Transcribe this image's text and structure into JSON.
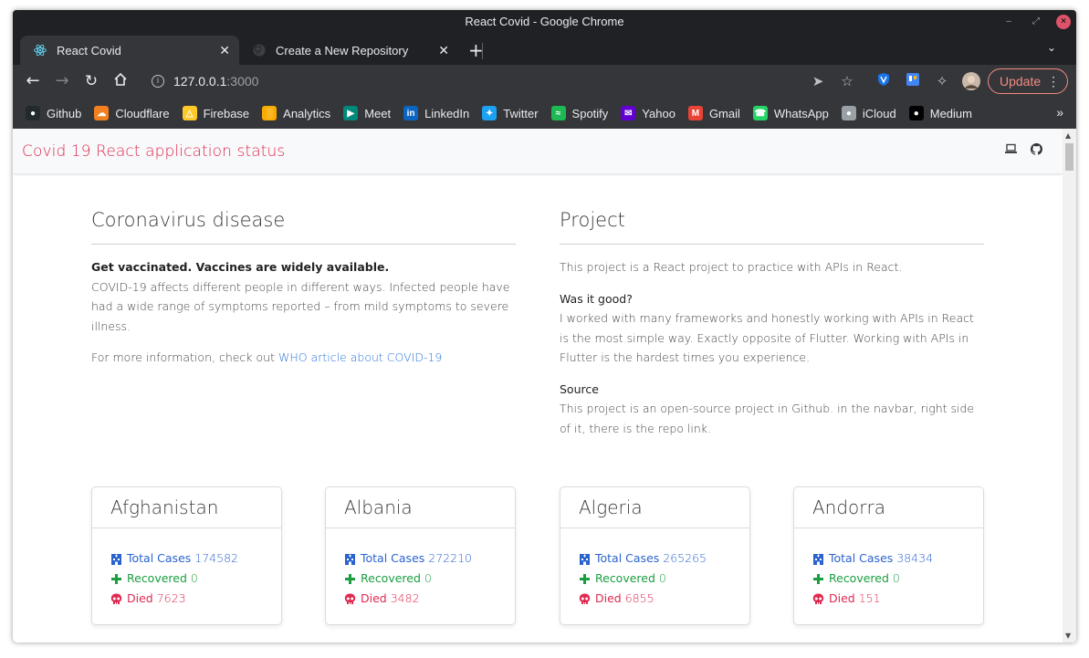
{
  "window": {
    "title": "React Covid - Google Chrome"
  },
  "tabs": [
    {
      "label": "React Covid",
      "active": true,
      "icon": "react-icon"
    },
    {
      "label": "Create a New Repository",
      "active": false,
      "icon": "github-icon"
    }
  ],
  "address": {
    "host": "127.0.0.1",
    "port": ":3000"
  },
  "update_label": "Update",
  "bookmarks": [
    {
      "label": "Github",
      "icon": "github-icon",
      "color": "#24292e"
    },
    {
      "label": "Cloudflare",
      "icon": "cloudflare-icon",
      "color": "#f38020"
    },
    {
      "label": "Firebase",
      "icon": "firebase-icon",
      "color": "#ffca28"
    },
    {
      "label": "Analytics",
      "icon": "analytics-icon",
      "color": "#f9ab00"
    },
    {
      "label": "Meet",
      "icon": "meet-icon",
      "color": "#00897b"
    },
    {
      "label": "LinkedIn",
      "icon": "linkedin-icon",
      "color": "#0a66c2"
    },
    {
      "label": "Twitter",
      "icon": "twitter-icon",
      "color": "#1da1f2"
    },
    {
      "label": "Spotify",
      "icon": "spotify-icon",
      "color": "#1db954"
    },
    {
      "label": "Yahoo",
      "icon": "yahoo-icon",
      "color": "#6001d2"
    },
    {
      "label": "Gmail",
      "icon": "gmail-icon",
      "color": "#ea4335"
    },
    {
      "label": "WhatsApp",
      "icon": "whatsapp-icon",
      "color": "#25d366"
    },
    {
      "label": "iCloud",
      "icon": "apple-icon",
      "color": "#9aa0a6"
    },
    {
      "label": "Medium",
      "icon": "medium-icon",
      "color": "#000000"
    }
  ],
  "navbar": {
    "brand": "Covid 19 React application status"
  },
  "covid": {
    "title": "Coronavirus disease",
    "lead": "Get vaccinated. Vaccines are widely available.",
    "body": "COVID-19 affects different people in different ways. Infected people have had a wide range of symptoms reported – from mild symptoms to severe illness.",
    "more_prefix": "For more information, check out ",
    "more_link": "WHO article about COVID-19"
  },
  "project": {
    "title": "Project",
    "intro": "This project is a React project to practice with APIs in React.",
    "q1": "Was it good?",
    "a1": "I worked with many frameworks and honestly working with APIs in React is the most simple way. Exactly opposite of Flutter. Working with APIs in Flutter is the hardest times you experience.",
    "q2": "Source",
    "a2": "This project is an open-source project in Github. in the navbar, right side of it, there is the repo link."
  },
  "labels": {
    "total": "Total Cases",
    "recovered": "Recovered",
    "died": "Died"
  },
  "countries": [
    {
      "name": "Afghanistan",
      "total": "174582",
      "recovered": "0",
      "died": "7623"
    },
    {
      "name": "Albania",
      "total": "272210",
      "recovered": "0",
      "died": "3482"
    },
    {
      "name": "Algeria",
      "total": "265265",
      "recovered": "0",
      "died": "6855"
    },
    {
      "name": "Andorra",
      "total": "38434",
      "recovered": "0",
      "died": "151"
    }
  ],
  "colors": {
    "brand": "#e0294f",
    "total": "#2a63cf",
    "recovered": "#1a9e3f",
    "died": "#e0294f"
  }
}
